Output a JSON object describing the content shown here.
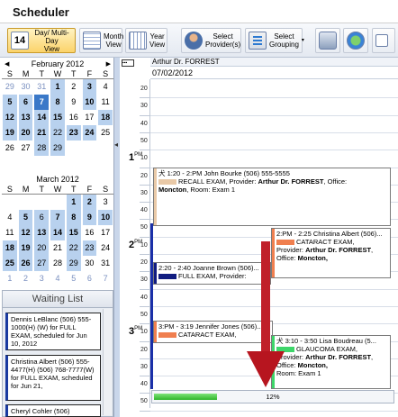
{
  "app": {
    "title": "Scheduler"
  },
  "toolbar": {
    "day_view": "Day/ Multi-Day\nView",
    "day_icon": "14",
    "month_view": "Month\nView",
    "year_view": "Year\nView",
    "select_providers": "Select\nProvider(s)",
    "select_grouping": "Select\nGrouping"
  },
  "calendar_feb": {
    "title": "February 2012",
    "dow": [
      "S",
      "M",
      "T",
      "W",
      "T",
      "F",
      "S"
    ],
    "days": [
      {
        "t": "29",
        "c": "o"
      },
      {
        "t": "30",
        "c": "o"
      },
      {
        "t": "31",
        "c": "o"
      },
      {
        "t": "1",
        "c": "hl b"
      },
      {
        "t": "2",
        "c": ""
      },
      {
        "t": "3",
        "c": "hl b"
      },
      {
        "t": "4",
        "c": ""
      },
      {
        "t": "5",
        "c": "hl b"
      },
      {
        "t": "6",
        "c": "hl b"
      },
      {
        "t": "7",
        "c": "sel b"
      },
      {
        "t": "8",
        "c": "hl b"
      },
      {
        "t": "9",
        "c": ""
      },
      {
        "t": "10",
        "c": "hl b"
      },
      {
        "t": "11",
        "c": ""
      },
      {
        "t": "12",
        "c": "hl b"
      },
      {
        "t": "13",
        "c": "hl b"
      },
      {
        "t": "14",
        "c": "hl b"
      },
      {
        "t": "15",
        "c": "hl b"
      },
      {
        "t": "16",
        "c": ""
      },
      {
        "t": "17",
        "c": ""
      },
      {
        "t": "18",
        "c": "hl b"
      },
      {
        "t": "19",
        "c": "hl b"
      },
      {
        "t": "20",
        "c": "hl b"
      },
      {
        "t": "21",
        "c": "hl b"
      },
      {
        "t": "22",
        "c": "hl"
      },
      {
        "t": "23",
        "c": "hl b"
      },
      {
        "t": "24",
        "c": "hl b"
      },
      {
        "t": "25",
        "c": ""
      },
      {
        "t": "26",
        "c": ""
      },
      {
        "t": "27",
        "c": ""
      },
      {
        "t": "28",
        "c": "hl"
      },
      {
        "t": "29",
        "c": "hl"
      }
    ]
  },
  "calendar_mar": {
    "title": "March 2012",
    "dow": [
      "S",
      "M",
      "T",
      "W",
      "T",
      "F",
      "S"
    ],
    "days": [
      {
        "t": "",
        "c": ""
      },
      {
        "t": "",
        "c": ""
      },
      {
        "t": "",
        "c": ""
      },
      {
        "t": "",
        "c": ""
      },
      {
        "t": "1",
        "c": "hl b"
      },
      {
        "t": "2",
        "c": "hl b"
      },
      {
        "t": "3",
        "c": ""
      },
      {
        "t": "4",
        "c": ""
      },
      {
        "t": "5",
        "c": "hl b"
      },
      {
        "t": "6",
        "c": "hl"
      },
      {
        "t": "7",
        "c": "hl b"
      },
      {
        "t": "8",
        "c": "hl b"
      },
      {
        "t": "9",
        "c": "hl b"
      },
      {
        "t": "10",
        "c": "hl b"
      },
      {
        "t": "11",
        "c": ""
      },
      {
        "t": "12",
        "c": "hl b"
      },
      {
        "t": "13",
        "c": "hl b"
      },
      {
        "t": "14",
        "c": "hl b"
      },
      {
        "t": "15",
        "c": "hl b"
      },
      {
        "t": "16",
        "c": ""
      },
      {
        "t": "17",
        "c": ""
      },
      {
        "t": "18",
        "c": "hl b"
      },
      {
        "t": "19",
        "c": "hl b"
      },
      {
        "t": "20",
        "c": "hl"
      },
      {
        "t": "21",
        "c": ""
      },
      {
        "t": "22",
        "c": "hl"
      },
      {
        "t": "23",
        "c": "hl"
      },
      {
        "t": "24",
        "c": ""
      },
      {
        "t": "25",
        "c": "hl b"
      },
      {
        "t": "26",
        "c": "hl b"
      },
      {
        "t": "27",
        "c": "hl"
      },
      {
        "t": "28",
        "c": ""
      },
      {
        "t": "29",
        "c": "hl"
      },
      {
        "t": "30",
        "c": ""
      },
      {
        "t": "31",
        "c": ""
      },
      {
        "t": "1",
        "c": "o"
      },
      {
        "t": "2",
        "c": "o"
      },
      {
        "t": "3",
        "c": "o"
      },
      {
        "t": "4",
        "c": "o"
      },
      {
        "t": "5",
        "c": "o"
      },
      {
        "t": "6",
        "c": "o"
      },
      {
        "t": "7",
        "c": "o"
      }
    ]
  },
  "waiting_list": {
    "title": "Waiting List",
    "items": [
      "Dennis LeBlanc (506) 555-1000(H) (W) for FULL EXAM, scheduled for Jun 10, 2012",
      "Christina Albert (506) 555-4477(H) (506) 768-7777(W) for FULL EXAM, scheduled for Jun 21,",
      "Cheryl Cohler (506)"
    ]
  },
  "schedule": {
    "provider": "Arthur Dr. FORREST",
    "date": "07/02/2012",
    "minute_marks": [
      "20",
      "30",
      "40",
      "50",
      "10",
      "20",
      "30",
      "40",
      "50",
      "10",
      "20",
      "30",
      "40",
      "50",
      "10",
      "20",
      "30",
      "40",
      "50"
    ],
    "hours": [
      {
        "h": "1",
        "ap": "PM"
      },
      {
        "h": "2",
        "ap": "PM"
      },
      {
        "h": "3",
        "ap": "PM"
      }
    ],
    "appointments": [
      {
        "head": "1:20 - 2:PM John Bourke (506) 555-5555",
        "type": "RECALL EXAM, Provider:",
        "prov": "Arthur Dr. FORREST",
        "rest": ", Office:",
        "office": "Moncton",
        "room": ", Room: Exam 1",
        "color": "#e9c9a7"
      },
      {
        "head": "2:PM - 2:25 Christina Albert (506)...",
        "type": "CATARACT EXAM,",
        "pre": "Provider:",
        "prov": "Arthur Dr. FORREST",
        "rest": ", Office:",
        "office": "Moncton,",
        "color": "#f07f4f"
      },
      {
        "head": "2:20 - 2:40 Joanne Brown (506)...",
        "type": "FULL EXAM, Provider:",
        "color": "#101c80"
      },
      {
        "head": "3:PM - 3:19 Jennifer Jones (506)...",
        "type": "CATARACT EXAM,",
        "color": "#f07f4f"
      },
      {
        "head": "3:10 - 3:50 Lisa Boudreau (5...",
        "type": "GLAUCOMA EXAM,",
        "pre": "Provider:",
        "prov": "Arthur Dr. FORREST",
        "rest": ", Office:",
        "office": "Moncton,",
        "room": "Room: Exam 1",
        "color": "#3ed66a"
      }
    ]
  },
  "progress": {
    "label": "12%",
    "value": 0.12
  }
}
